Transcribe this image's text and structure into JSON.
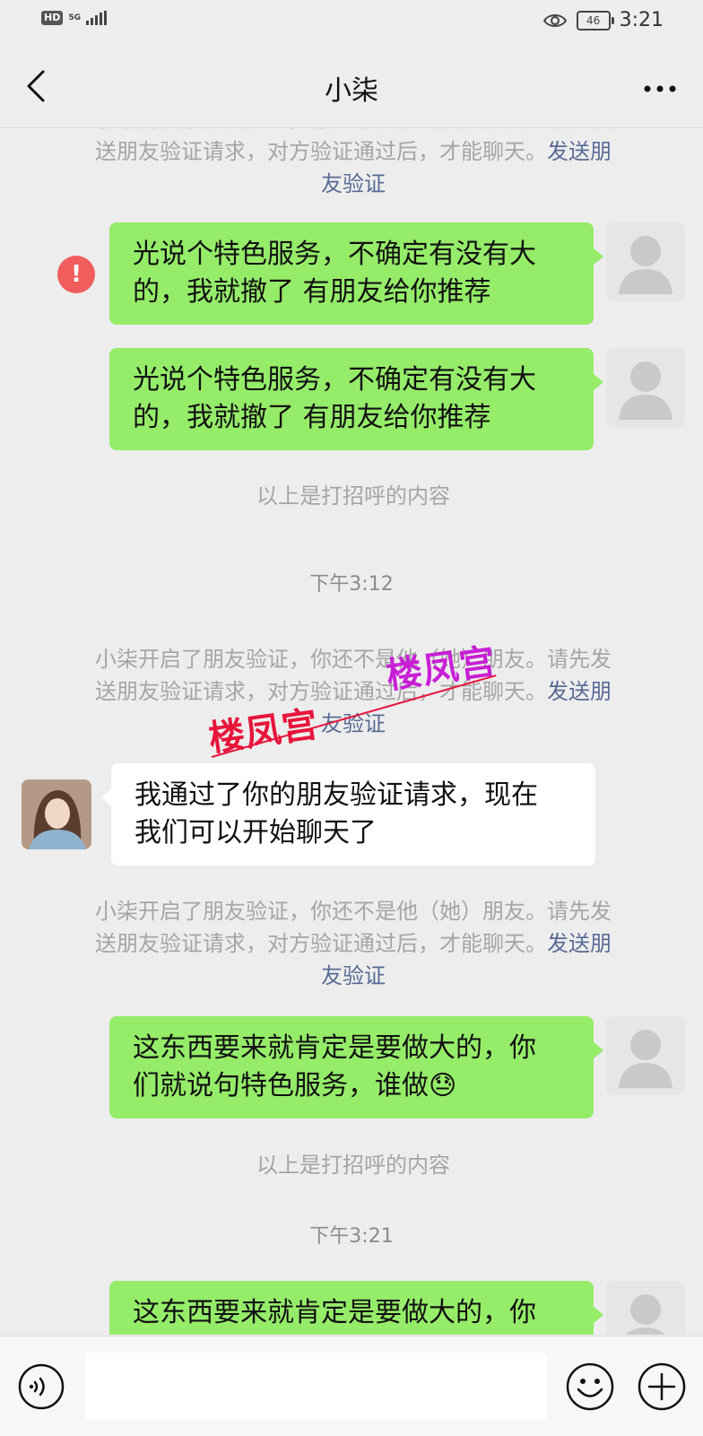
{
  "status_bar": {
    "hd_label": "HD",
    "network_label": "5G",
    "battery_level": "46",
    "time": "3:21"
  },
  "header": {
    "title": "小柒"
  },
  "messages": {
    "sys_top": {
      "line1": "小柒开启了朋友验证，你还不是他（她）朋友。请先发",
      "line2_text": "送朋友验证请求，对方验证通过后，才能聊天。",
      "line2_link": "发送朋",
      "line3_link": "友验证"
    },
    "msg1": {
      "warn_label": "!",
      "line1": "光说个特色服务，不确定有没有大",
      "line2": "的，我就撤了  有朋友给你推荐"
    },
    "msg2": {
      "line1": "光说个特色服务，不确定有没有大",
      "line2": "的，我就撤了  有朋友给你推荐"
    },
    "greeting_note_1": "以上是打招呼的内容",
    "timestamp_1": "下午3:12",
    "sys_mid": {
      "line1": "小柒开启了朋友验证，你还不是他（她）朋友。请先发",
      "line2_text": "送朋友验证请求，对方验证通过后，才能聊天。",
      "line2_link": "发送朋",
      "line3_link": "友验证"
    },
    "msg3": {
      "line1": "我通过了你的朋友验证请求，现在",
      "line2": "我们可以开始聊天了"
    },
    "sys_low": {
      "line1": "小柒开启了朋友验证，你还不是他（她）朋友。请先发",
      "line2_text": "送朋友验证请求，对方验证通过后，才能聊天。",
      "line2_link": "发送朋",
      "line3_link": "友验证"
    },
    "msg4": {
      "line1": "这东西要来就肯定是要做大的，你",
      "line2": "们就说句特色服务，谁做",
      "emoji": "😓"
    },
    "greeting_note_2": "以上是打招呼的内容",
    "timestamp_2": "下午3:21",
    "msg5": {
      "line1": "这东西要来就肯定是要做大的，你"
    }
  },
  "watermark": {
    "text_1": "楼凤宫",
    "text_2": "楼凤宫"
  },
  "input_bar": {
    "placeholder": ""
  },
  "colors": {
    "background": "#ededed",
    "my_bubble": "#95ec69",
    "their_bubble": "#ffffff",
    "link": "#586b95",
    "warning": "#f05d5d"
  },
  "icons": {
    "back": "chevron-left-icon",
    "more": "more-dots-icon",
    "voice": "voice-icon",
    "emoji": "emoji-icon",
    "plus": "plus-icon"
  }
}
